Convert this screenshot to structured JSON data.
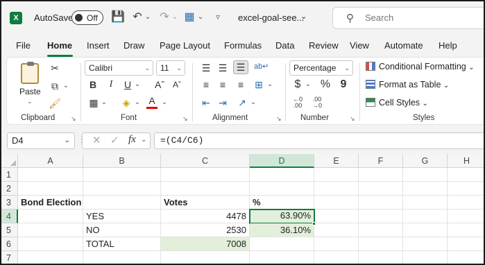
{
  "titlebar": {
    "app_icon_letter": "X",
    "autosave_label": "AutoSave",
    "autosave_state": "Off",
    "doc_title": "excel-goal-see...",
    "search_placeholder": "Search",
    "icons": [
      "save-icon",
      "undo-icon",
      "redo-icon",
      "table-icon",
      "customize-qat-icon"
    ]
  },
  "tabs": [
    {
      "label": "File"
    },
    {
      "label": "Home",
      "active": true
    },
    {
      "label": "Insert"
    },
    {
      "label": "Draw"
    },
    {
      "label": "Page Layout"
    },
    {
      "label": "Formulas"
    },
    {
      "label": "Data"
    },
    {
      "label": "Review"
    },
    {
      "label": "View"
    },
    {
      "label": "Automate"
    },
    {
      "label": "Help"
    }
  ],
  "ribbon": {
    "clipboard": {
      "label": "Clipboard",
      "paste_label": "Paste"
    },
    "font": {
      "label": "Font",
      "font_name": "Calibri",
      "font_size": "11",
      "bold": "B",
      "italic": "I",
      "underline": "U",
      "font_color_letter": "A"
    },
    "alignment": {
      "label": "Alignment"
    },
    "number": {
      "label": "Number",
      "format": "Percentage",
      "currency": "$",
      "percent": "%",
      "comma": "9",
      "inc_decimal": "←0 .00",
      "dec_decimal": ".00 →0"
    },
    "styles": {
      "label": "Styles",
      "conditional": "Conditional Formatting",
      "format_table": "Format as Table",
      "cell_styles": "Cell Styles"
    }
  },
  "formula_bar": {
    "name_box": "D4",
    "fx": "fx",
    "formula": "=(C4/C6)"
  },
  "sheet": {
    "columns": [
      "A",
      "B",
      "C",
      "D",
      "E",
      "F",
      "G",
      "H"
    ],
    "selected_column": "D",
    "rows": [
      "1",
      "2",
      "3",
      "4",
      "5",
      "6",
      "7"
    ],
    "selected_row": "4",
    "cells": {
      "A3": "Bond Election",
      "B4": "YES",
      "B5": "NO",
      "B6": "TOTAL",
      "C3": "Votes",
      "C4": "4478",
      "C5": "2530",
      "C6": "7008",
      "D3": "%",
      "D4": "63.90%",
      "D5": "36.10%"
    },
    "colors": {
      "accent": "#107c41",
      "green_fill": "#e2efda"
    }
  }
}
